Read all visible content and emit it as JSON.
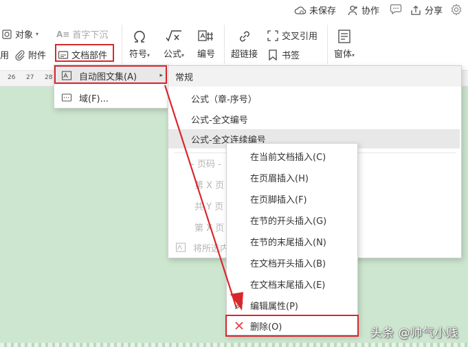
{
  "topbar": {
    "unsaved": "未保存",
    "collaborate": "协作",
    "share": "分享"
  },
  "ribbon": {
    "object": "对象",
    "attachment": "附件",
    "drop_cap": "首字下沉",
    "doc_parts": "文档部件",
    "symbol": "符号",
    "formula": "公式",
    "numbering": "编号",
    "hyperlink": "超链接",
    "cross_reference": "交叉引用",
    "bookmark": "书签",
    "window": "窗体",
    "left_edge_char": "用"
  },
  "ruler": {
    "ticks": [
      "26",
      "27",
      "28"
    ]
  },
  "menu1": {
    "autotext": "自动图文集(A)",
    "field": "域(F)..."
  },
  "menu2": {
    "section_title": "常规",
    "items": [
      "公式（章-序号）",
      "公式-全文编号",
      "公式-全文连续编号"
    ],
    "page_label": "- 页码 -",
    "page_x": "第 X 页",
    "total_y": "共 Y 页",
    "page_x_total_y": "第 X 页",
    "save_selection": "将所选内容"
  },
  "menu3": {
    "items": [
      "在当前文档插入(C)",
      "在页眉插入(H)",
      "在页脚插入(F)",
      "在节的开头插入(G)",
      "在节的末尾插入(N)",
      "在文档开头插入(B)",
      "在文档末尾插入(E)"
    ],
    "edit_properties": "编辑属性(P)",
    "delete": "删除(O)"
  },
  "watermark": "头条 @帅气小贱",
  "colors": {
    "annotation_red": "#d9262c",
    "document_bg": "#cde6cf",
    "highlight": "#e8e8e8"
  }
}
